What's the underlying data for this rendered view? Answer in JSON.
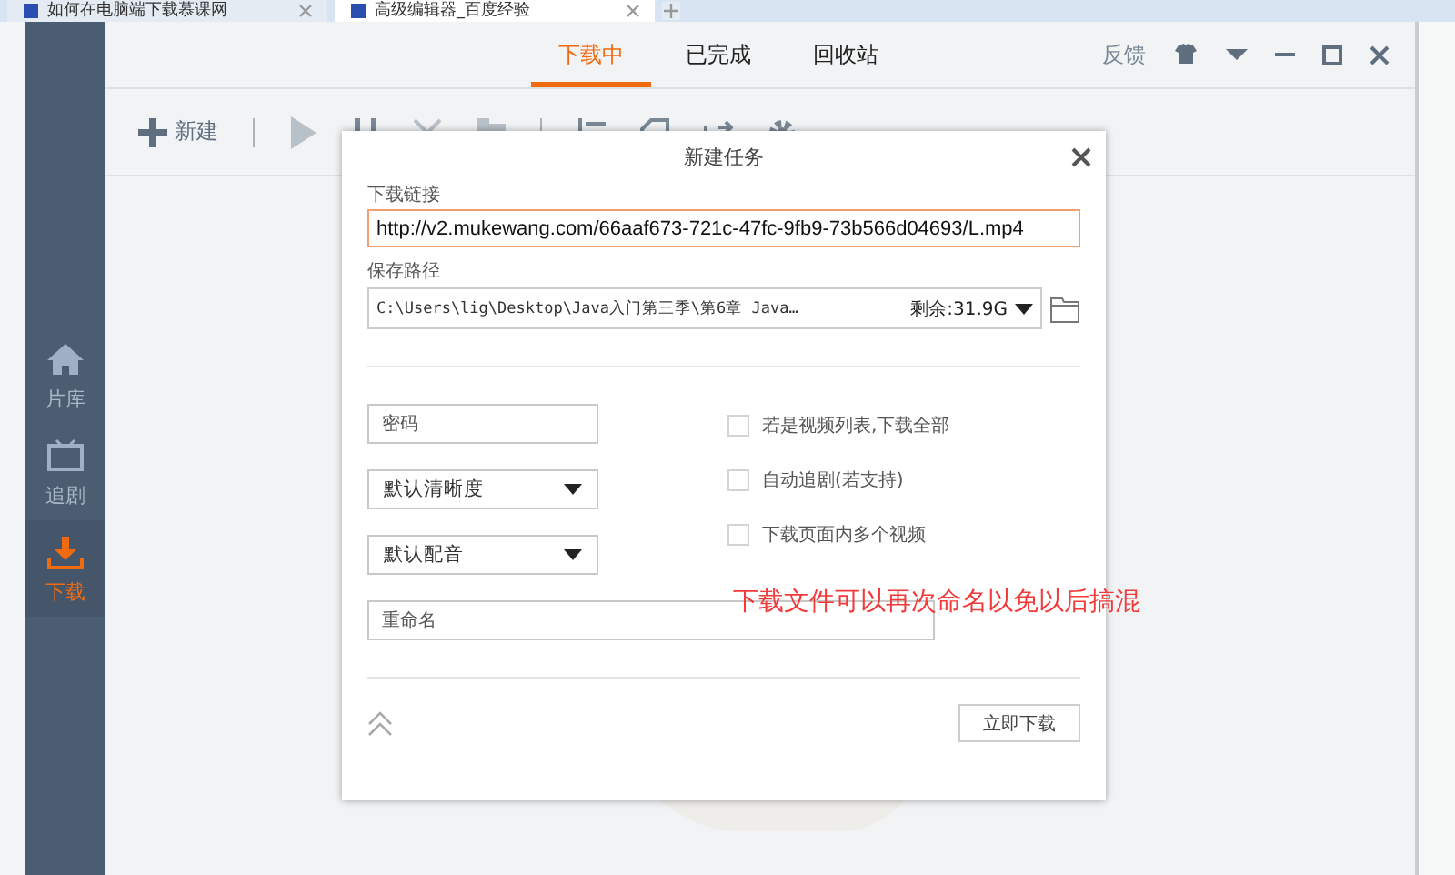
{
  "browser_tabs": [
    {
      "title": "如何在电脑端下载慕课网",
      "selected": false
    },
    {
      "title": "高级编辑器_百度经验",
      "selected": true
    }
  ],
  "sidebar": {
    "items": [
      {
        "label": "片库",
        "selected": false
      },
      {
        "label": "追剧",
        "selected": false
      },
      {
        "label": "下载",
        "selected": true
      }
    ]
  },
  "header": {
    "tabs": [
      {
        "label": "下载中",
        "selected": true
      },
      {
        "label": "已完成",
        "selected": false
      },
      {
        "label": "回收站",
        "selected": false
      }
    ],
    "feedback": "反馈"
  },
  "toolbar": {
    "new_label": "新建"
  },
  "dialog": {
    "title": "新建任务",
    "link_label": "下载链接",
    "link_value": "http://v2.mukewang.com/66aaf673-721c-47fc-9fb9-73b566d04693/L.mp4",
    "path_label": "保存路径",
    "path_value": "C:\\Users\\lig\\Desktop\\Java入门第三季\\第6章 Java…",
    "free_space": "剩余:31.9G",
    "password_placeholder": "密码",
    "quality": "默认清晰度",
    "dubbing": "默认配音",
    "rename_placeholder": "重命名",
    "options": [
      {
        "label": "若是视频列表,下载全部",
        "checked": false
      },
      {
        "label": "自动追剧(若支持)",
        "checked": false
      },
      {
        "label": "下载页面内多个视频",
        "checked": false
      }
    ],
    "submit": "立即下载"
  },
  "annotation": "下载文件可以再次命名以免以后搞混"
}
